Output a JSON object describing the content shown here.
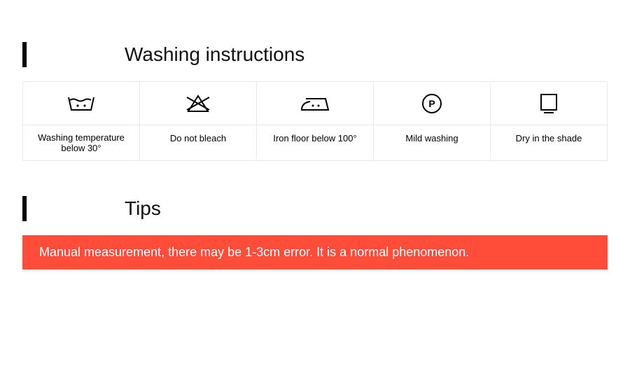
{
  "sections": {
    "washing": {
      "title": "Washing instructions",
      "items": [
        {
          "icon": "wash-30-icon",
          "label": "Washing temperature below 30°"
        },
        {
          "icon": "no-bleach-icon",
          "label": "Do not bleach"
        },
        {
          "icon": "iron-100-icon",
          "label": "Iron floor below 100°"
        },
        {
          "icon": "mild-wash-icon",
          "label": "Mild washing"
        },
        {
          "icon": "shade-dry-icon",
          "label": "Dry in the shade"
        }
      ]
    },
    "tips": {
      "title": "Tips",
      "banner_text": "Manual measurement, there may be 1-3cm error. It is a normal phenomenon.",
      "banner_color": "#ff4d3a"
    }
  }
}
